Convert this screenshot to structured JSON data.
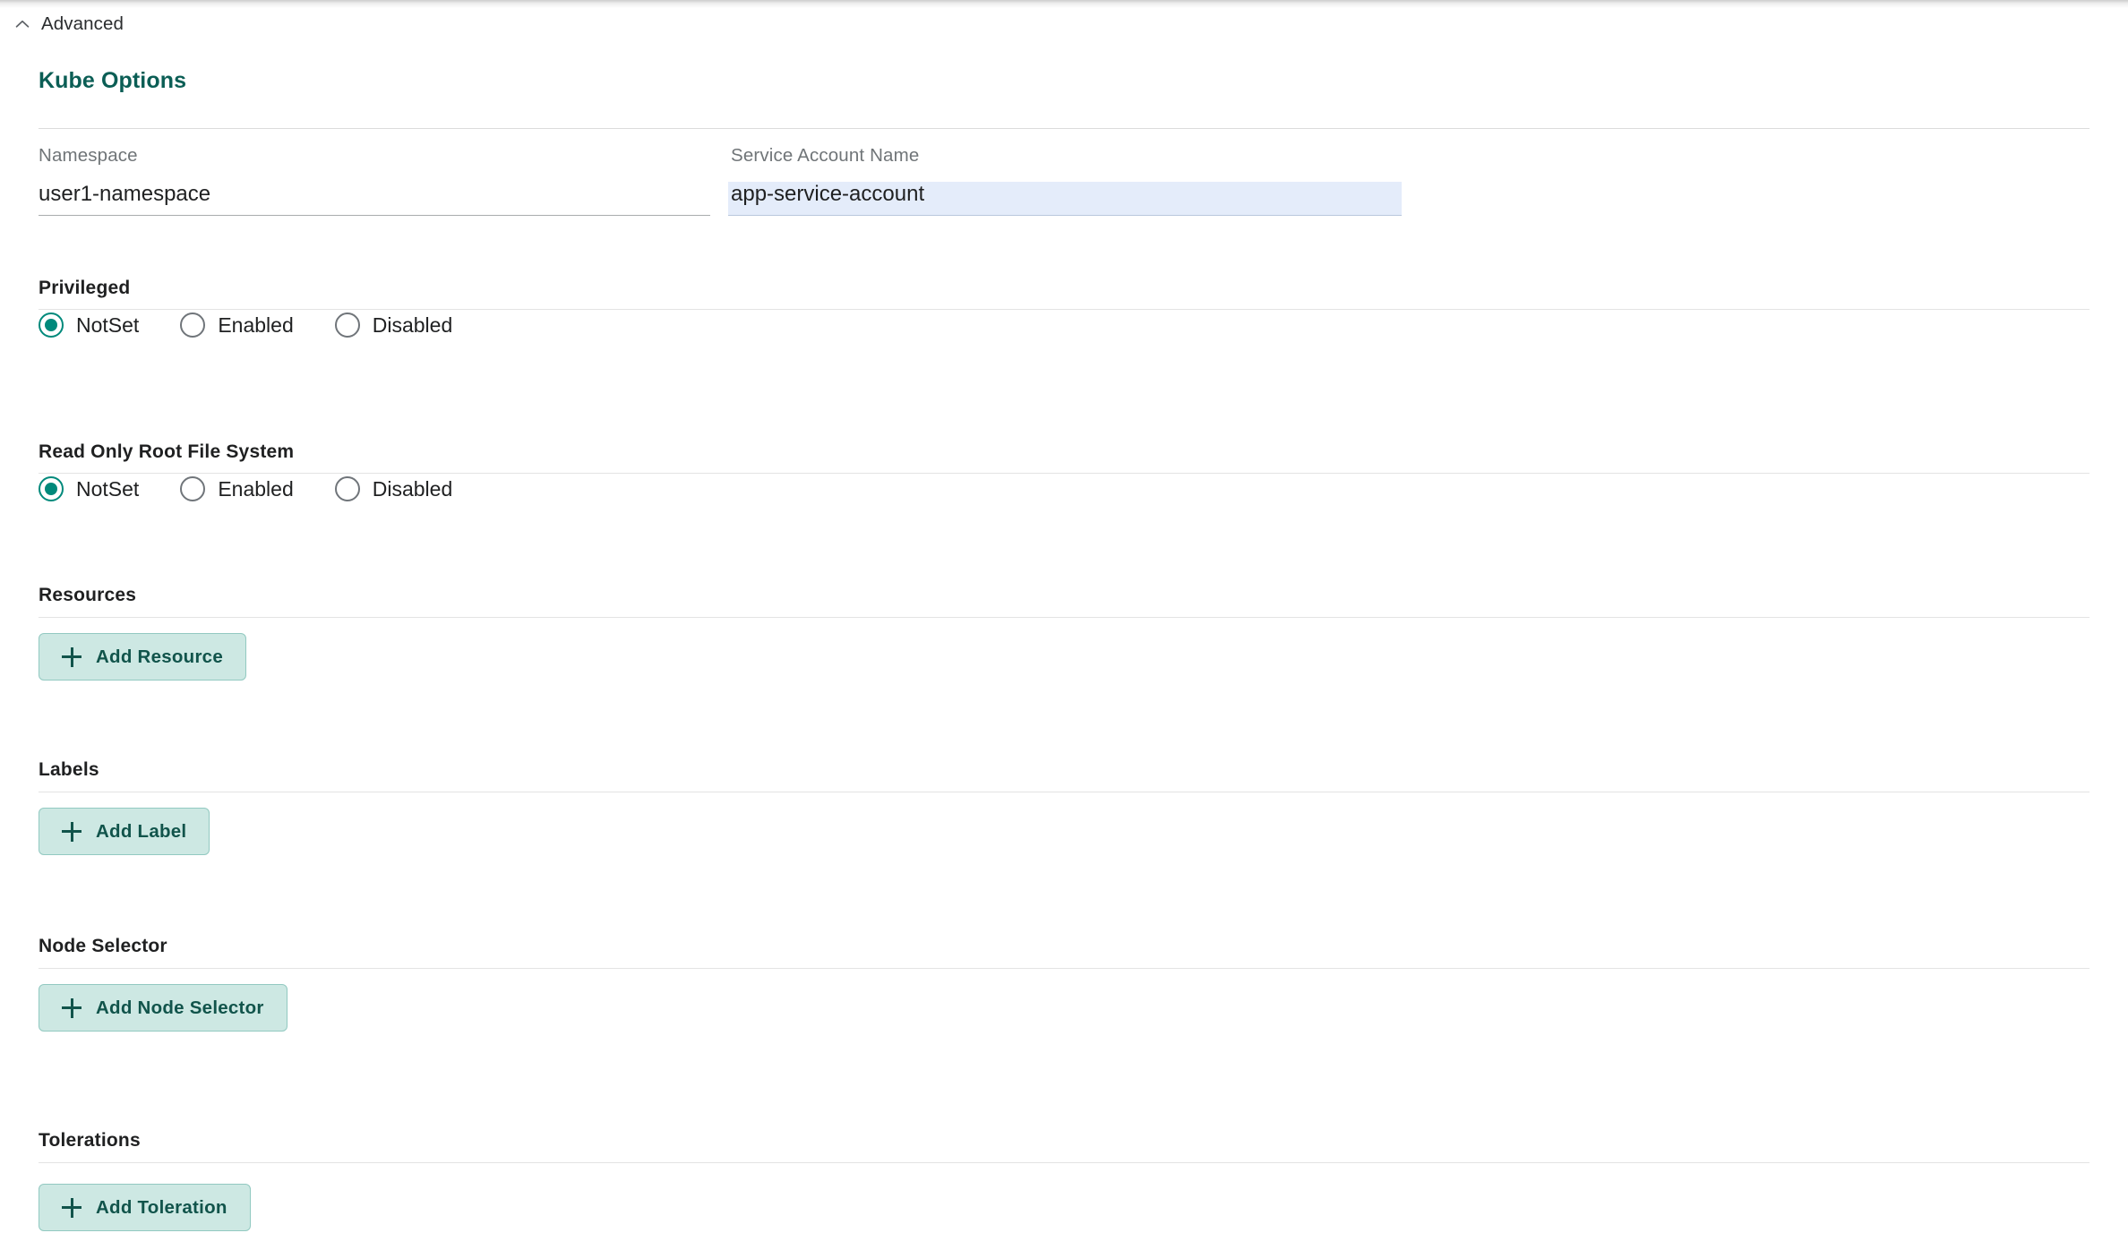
{
  "collapser": {
    "label": "Advanced",
    "expanded": true,
    "chevron": "chevron-up-icon"
  },
  "panel": {
    "title": "Kube Options",
    "title_color": "#0b5e55"
  },
  "fields": {
    "namespace": {
      "label": "Namespace",
      "value": "user1-namespace",
      "placeholder": "",
      "highlighted": false
    },
    "service_account_name": {
      "label": "Service Account Name",
      "value": "app-service-account",
      "placeholder": "",
      "highlighted": true,
      "highlight_color": "#e4ecfa"
    }
  },
  "radio_sections": [
    {
      "title": "Privileged",
      "options": [
        {
          "label": "NotSet",
          "selected": true
        },
        {
          "label": "Enabled",
          "selected": false
        },
        {
          "label": "Disabled",
          "selected": false
        }
      ]
    },
    {
      "title": "Read Only Root File System",
      "options": [
        {
          "label": "NotSet",
          "selected": true
        },
        {
          "label": "Enabled",
          "selected": false
        },
        {
          "label": "Disabled",
          "selected": false
        }
      ]
    }
  ],
  "list_sections": [
    {
      "title": "Resources",
      "button_label": "Add Resource"
    },
    {
      "title": "Labels",
      "button_label": "Add Label"
    },
    {
      "title": "Node Selector",
      "button_label": "Add Node Selector"
    },
    {
      "title": "Tolerations",
      "button_label": "Add Toleration"
    }
  ],
  "colors": {
    "accent_teal": "#00897b",
    "heading_teal": "#0b5e55",
    "button_bg": "#cde8e3",
    "button_border": "#92c9c1",
    "button_text": "#11544b",
    "divider": "#e3e3e3",
    "label_grey": "#707578"
  }
}
